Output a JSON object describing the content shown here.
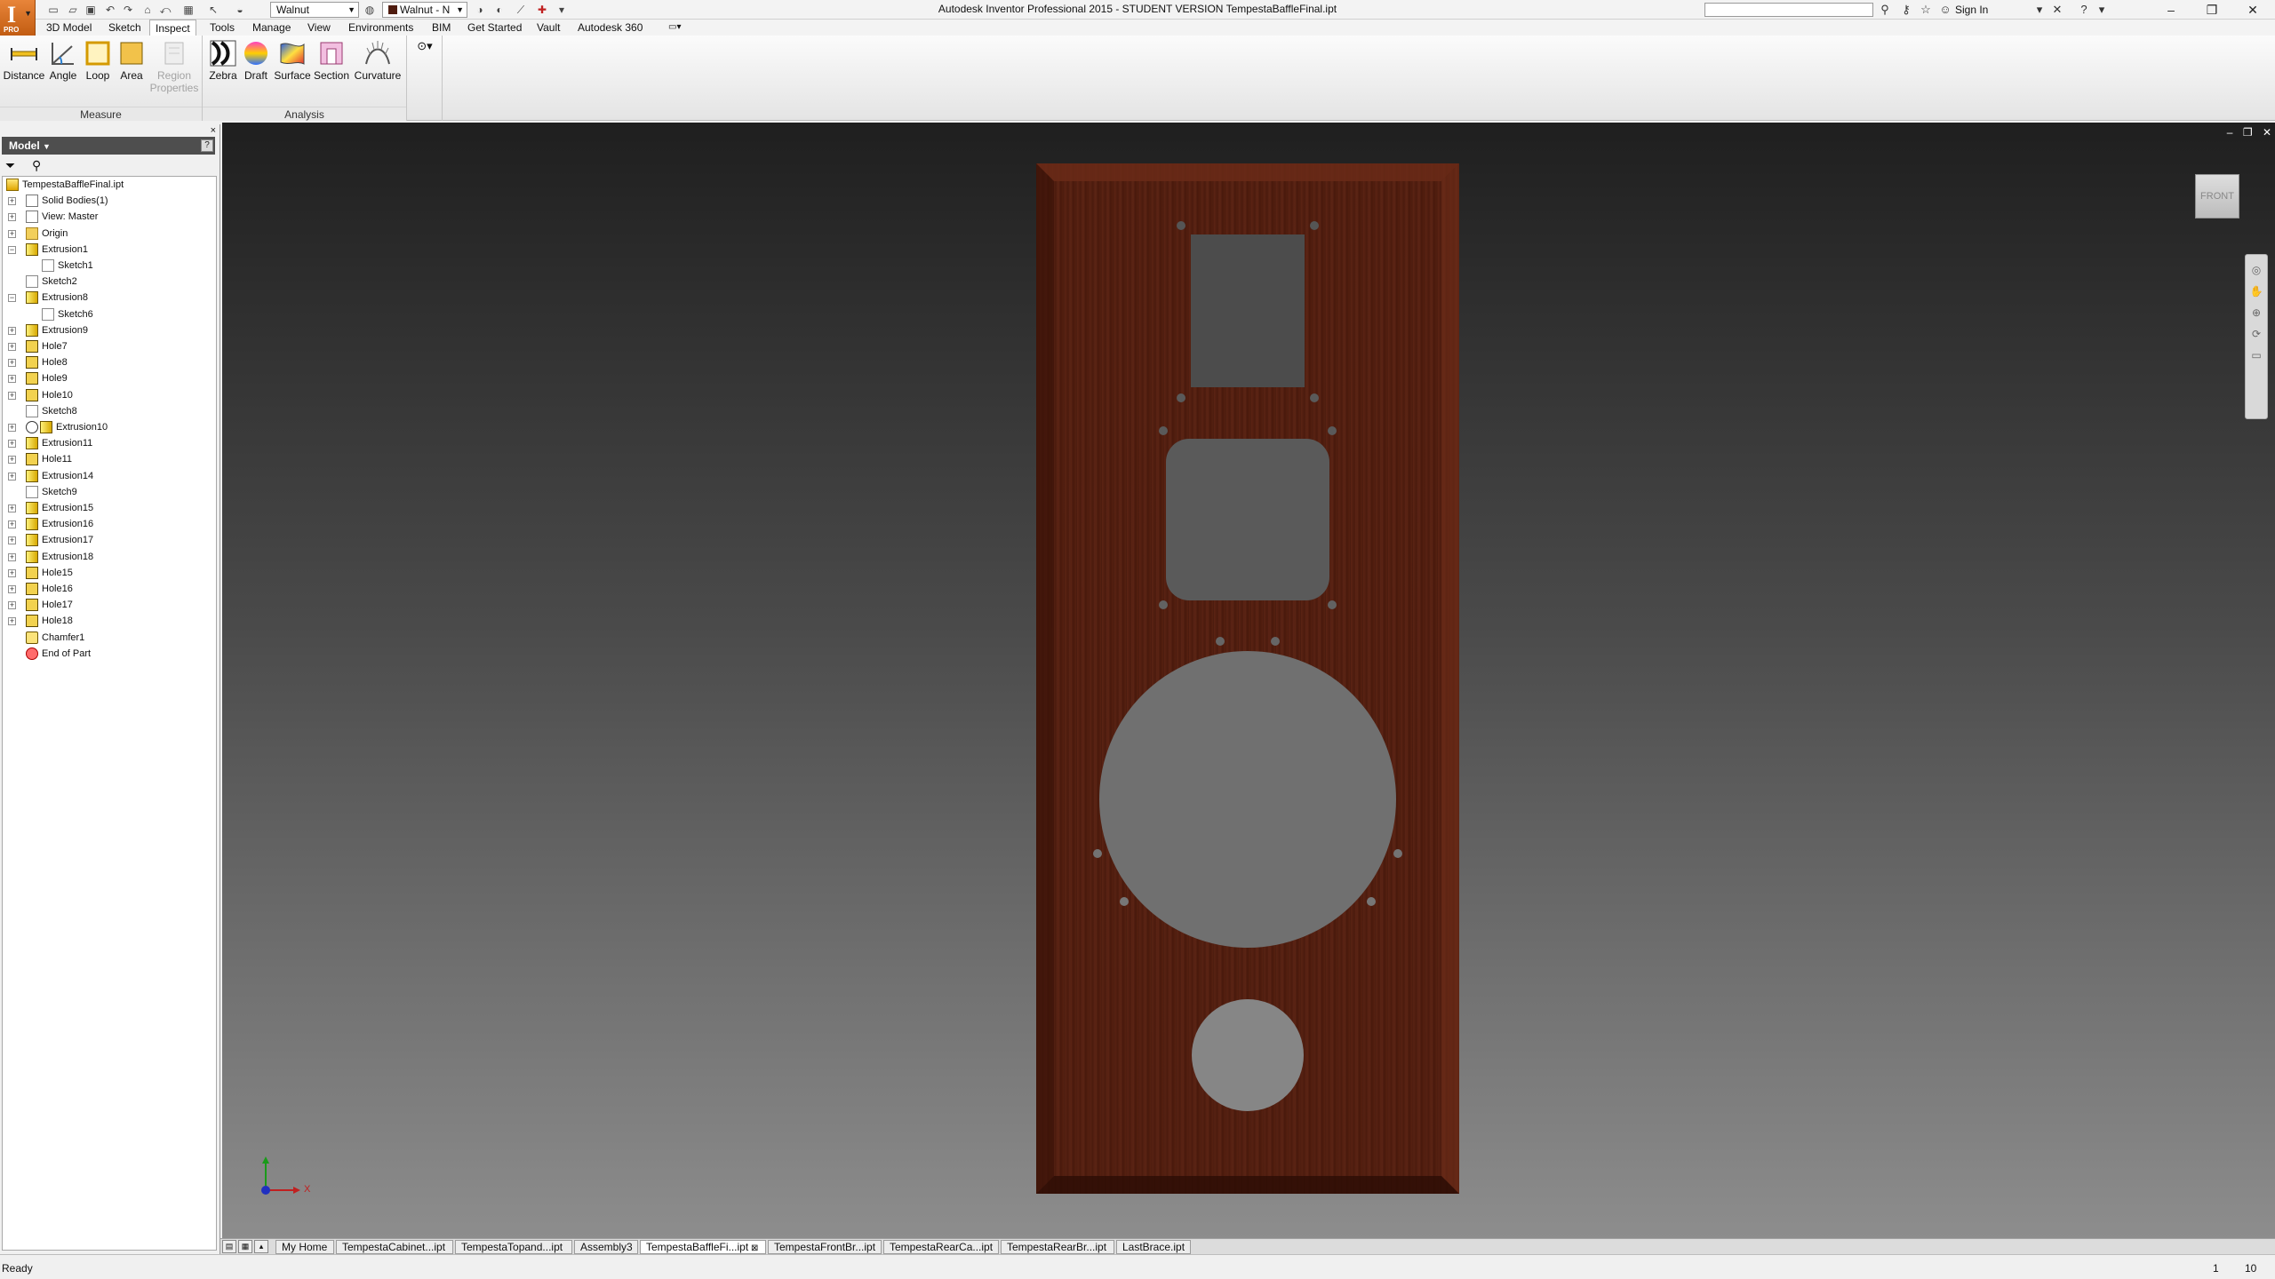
{
  "window": {
    "title": "Autodesk Inventor Professional 2015 - STUDENT VERSION   TempestaBaffleFinal.ipt",
    "app_badge": "PRO",
    "appearance_select": "Walnut",
    "material_select": "Walnut - N",
    "sign_in": "Sign In",
    "search_placeholder": ""
  },
  "ribbon_tabs": [
    "3D Model",
    "Sketch",
    "Inspect",
    "Tools",
    "Manage",
    "View",
    "Environments",
    "BIM",
    "Get Started",
    "Vault",
    "Autodesk 360"
  ],
  "active_tab": "Inspect",
  "ribbon_groups": {
    "measure": {
      "label": "Measure",
      "buttons": [
        "Distance",
        "Angle",
        "Loop",
        "Area",
        "Region",
        "Properties"
      ]
    },
    "analysis": {
      "label": "Analysis",
      "buttons": [
        "Zebra",
        "Draft",
        "Surface",
        "Section",
        "Curvature"
      ]
    }
  },
  "browser": {
    "title": "Model",
    "help": "?",
    "close": "×",
    "tree": [
      {
        "label": "TempestaBaffleFinal.ipt",
        "icon": "part-icon",
        "level": 0,
        "expander": ""
      },
      {
        "label": "Solid Bodies(1)",
        "icon": "solid-bodies-icon",
        "level": 1,
        "expander": "+"
      },
      {
        "label": "View: Master",
        "icon": "view-icon",
        "level": 1,
        "expander": "+"
      },
      {
        "label": "Origin",
        "icon": "folder-icon",
        "level": 1,
        "expander": "+"
      },
      {
        "label": "Extrusion1",
        "icon": "extrude-icon",
        "level": 1,
        "expander": "−"
      },
      {
        "label": "Sketch1",
        "icon": "sketch-icon",
        "level": 2,
        "expander": ""
      },
      {
        "label": "Sketch2",
        "icon": "sketch-icon",
        "level": 1,
        "expander": ""
      },
      {
        "label": "Extrusion8",
        "icon": "extrude-icon",
        "level": 1,
        "expander": "−"
      },
      {
        "label": "Sketch6",
        "icon": "sketch-icon",
        "level": 2,
        "expander": ""
      },
      {
        "label": "Extrusion9",
        "icon": "extrude-icon",
        "level": 1,
        "expander": "+"
      },
      {
        "label": "Hole7",
        "icon": "hole-icon",
        "level": 1,
        "expander": "+"
      },
      {
        "label": "Hole8",
        "icon": "hole-icon",
        "level": 1,
        "expander": "+"
      },
      {
        "label": "Hole9",
        "icon": "hole-icon",
        "level": 1,
        "expander": "+"
      },
      {
        "label": "Hole10",
        "icon": "hole-icon",
        "level": 1,
        "expander": "+"
      },
      {
        "label": "Sketch8",
        "icon": "sketch-icon",
        "level": 1,
        "expander": ""
      },
      {
        "label": "Extrusion10",
        "icon": "extrude-icon",
        "level": 1,
        "expander": "+",
        "suppressed": true
      },
      {
        "label": "Extrusion11",
        "icon": "extrude-icon",
        "level": 1,
        "expander": "+"
      },
      {
        "label": "Hole11",
        "icon": "hole-icon",
        "level": 1,
        "expander": "+"
      },
      {
        "label": "Extrusion14",
        "icon": "extrude-icon",
        "level": 1,
        "expander": "+"
      },
      {
        "label": "Sketch9",
        "icon": "sketch-icon",
        "level": 1,
        "expander": ""
      },
      {
        "label": "Extrusion15",
        "icon": "extrude-icon",
        "level": 1,
        "expander": "+"
      },
      {
        "label": "Extrusion16",
        "icon": "extrude-icon",
        "level": 1,
        "expander": "+"
      },
      {
        "label": "Extrusion17",
        "icon": "extrude-icon",
        "level": 1,
        "expander": "+"
      },
      {
        "label": "Extrusion18",
        "icon": "extrude-icon",
        "level": 1,
        "expander": "+"
      },
      {
        "label": "Hole15",
        "icon": "hole-icon",
        "level": 1,
        "expander": "+"
      },
      {
        "label": "Hole16",
        "icon": "hole-icon",
        "level": 1,
        "expander": "+"
      },
      {
        "label": "Hole17",
        "icon": "hole-icon",
        "level": 1,
        "expander": "+"
      },
      {
        "label": "Hole18",
        "icon": "hole-icon",
        "level": 1,
        "expander": "+"
      },
      {
        "label": "Chamfer1",
        "icon": "chamfer-icon",
        "level": 1,
        "expander": ""
      },
      {
        "label": "End of Part",
        "icon": "end-of-part-icon",
        "level": 1,
        "expander": ""
      }
    ]
  },
  "viewport": {
    "viewcube_label": "FRONT",
    "axis_x": "X",
    "background_top": "#1f1f1f",
    "background_bottom": "#8d8d8d",
    "wood_color": "#4f1c0f"
  },
  "doc_tabs": [
    {
      "label": "My Home",
      "active": false
    },
    {
      "label": "TempestaCabinet...ipt",
      "active": false
    },
    {
      "label": "TempestaTopand...ipt",
      "active": false
    },
    {
      "label": "Assembly3",
      "active": false
    },
    {
      "label": "TempestaBaffleFi...ipt",
      "active": true
    },
    {
      "label": "TempestaFrontBr...ipt",
      "active": false
    },
    {
      "label": "TempestaRearCa...ipt",
      "active": false
    },
    {
      "label": "TempestaRearBr...ipt",
      "active": false
    },
    {
      "label": "LastBrace.ipt",
      "active": false
    }
  ],
  "status": {
    "text": "Ready",
    "count_a": "1",
    "count_b": "10"
  }
}
